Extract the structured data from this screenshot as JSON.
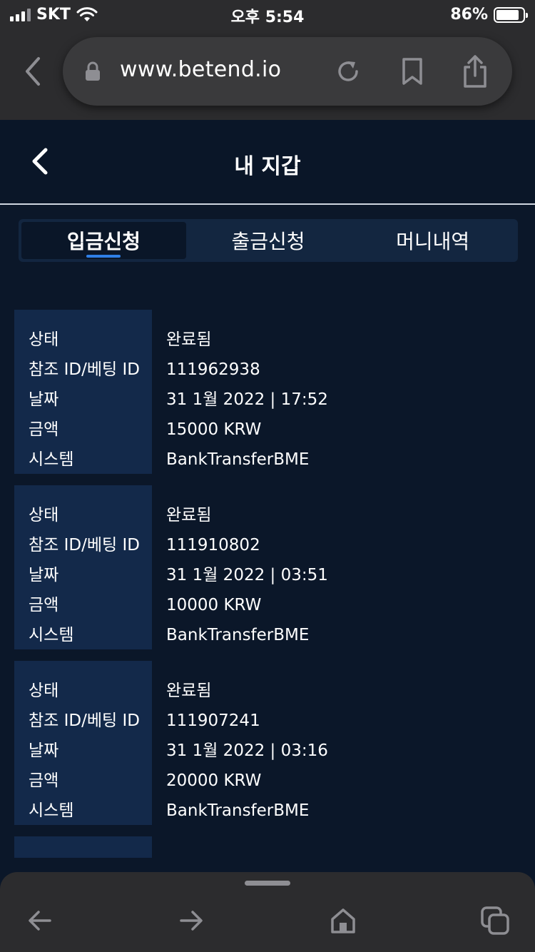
{
  "status_bar": {
    "carrier": "SKT",
    "time": "오후 5:54",
    "battery_percent": "86%",
    "battery_level": 0.86
  },
  "browser": {
    "url": "www.betend.io"
  },
  "header": {
    "title": "내 지갑"
  },
  "tabs": [
    {
      "label": "입금신청",
      "active": true
    },
    {
      "label": "출금신청",
      "active": false
    },
    {
      "label": "머니내역",
      "active": false
    }
  ],
  "field_labels": {
    "status": "상태",
    "ref_id": "참조 ID/베팅 ID",
    "date": "날짜",
    "amount": "금액",
    "system": "시스템"
  },
  "transactions": [
    {
      "status": "완료됨",
      "ref_id": "111962938",
      "date": "31 1월 2022 | 17:52",
      "amount": "15000 KRW",
      "system": "BankTransferBME"
    },
    {
      "status": "완료됨",
      "ref_id": "111910802",
      "date": "31 1월 2022 | 03:51",
      "amount": "10000 KRW",
      "system": "BankTransferBME"
    },
    {
      "status": "완료됨",
      "ref_id": "111907241",
      "date": "31 1월 2022 | 03:16",
      "amount": "20000 KRW",
      "system": "BankTransferBME"
    }
  ],
  "colors": {
    "page_bg": "#0b1729",
    "label_bg": "#13294a",
    "tab_indicator": "#2f7fe6",
    "browser_chrome": "#2c2c2e"
  },
  "icons": {
    "browser_back": "chevron-left-icon",
    "lock": "lock-icon",
    "reload": "reload-icon",
    "bookmark": "bookmark-icon",
    "share": "share-icon",
    "page_back": "chevron-left-icon",
    "toolbar": [
      "arrow-left-icon",
      "arrow-right-icon",
      "home-icon",
      "tabs-icon"
    ]
  }
}
